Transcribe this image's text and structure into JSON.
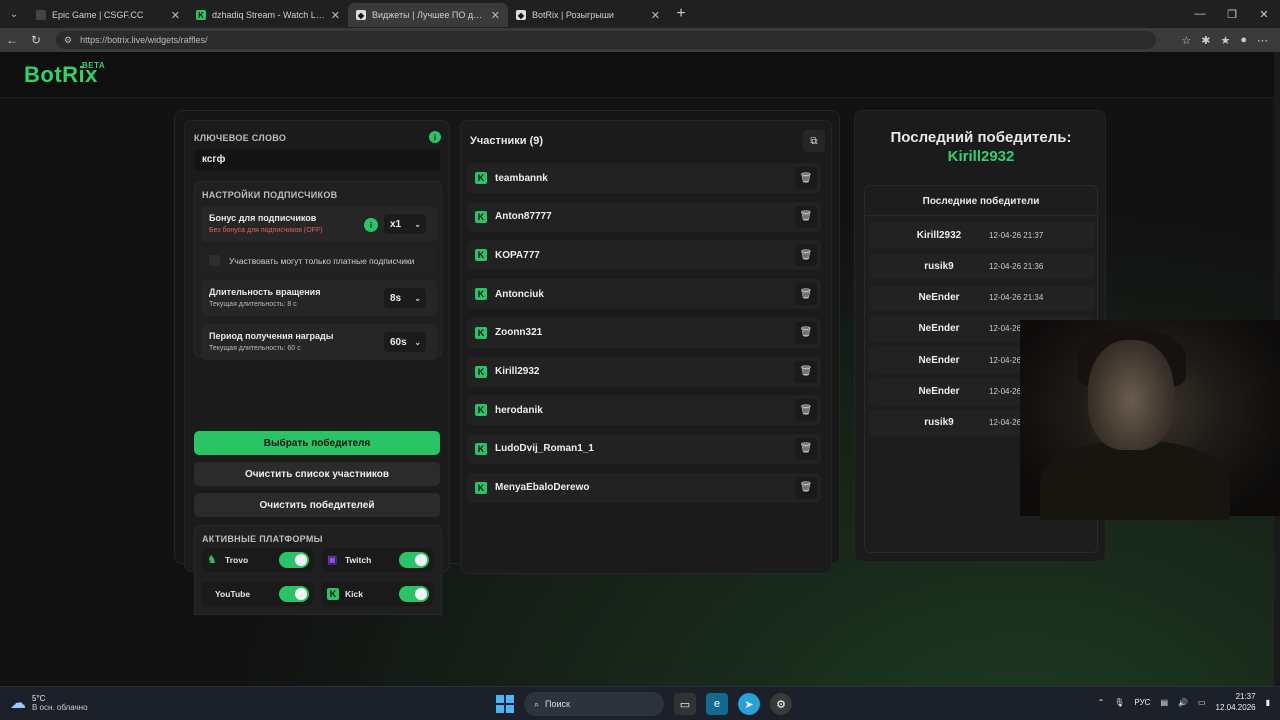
{
  "browser": {
    "tabs": [
      {
        "title": "Epic Game | CSGF.CC",
        "fav_color": "#444",
        "fav_glyph": ""
      },
      {
        "title": "dzhadiq Stream - Watch Live on K",
        "fav_color": "#28c466",
        "fav_glyph": "K"
      },
      {
        "title": "Виджеты | Лучшее ПО для улучш",
        "fav_color": "#ddd",
        "fav_glyph": "◆"
      },
      {
        "title": "BotRix | Розыгрыши",
        "fav_color": "#ddd",
        "fav_glyph": "◆"
      }
    ],
    "url": "https://botrix.live/widgets/raffles/"
  },
  "logo": {
    "name": "BotRix",
    "badge": "BETA"
  },
  "settings": {
    "keyword_label": "КЛЮЧЕВОЕ СЛОВО",
    "keyword_value": "ксгф",
    "subs_title": "НАСТРОЙКИ ПОДПИСЧИКОВ",
    "bonus_label": "Бонус для подписчиков",
    "bonus_sub": "Без бонуса для подписчиков (OFF)",
    "bonus_value": "x1",
    "paid_only_label": "Участвовать могут только платные подписчики",
    "spin_label": "Длительность вращения",
    "spin_sub": "Текущая длительность: 8 с",
    "spin_value": "8s",
    "claim_label": "Период получения награды",
    "claim_sub": "Текущая длительность: 60 с",
    "claim_value": "60s",
    "pick_winner": "Выбрать победителя",
    "clear_participants": "Очистить список участников",
    "clear_winners": "Очистить победителей",
    "platforms_title": "АКТИВНЫЕ ПЛАТФОРМЫ",
    "platforms": [
      {
        "name": "Trovo",
        "on": true
      },
      {
        "name": "Twitch",
        "on": true
      },
      {
        "name": "YouTube",
        "on": true
      },
      {
        "name": "Kick",
        "on": true
      }
    ]
  },
  "participants": {
    "title": "Участники (9)",
    "list": [
      "teambannk",
      "Anton87777",
      "KOPA777",
      "Antonciuk",
      "Zoonn321",
      "Kirill2932",
      "herodanik",
      "LudoDvij_Roman1_1",
      "MenyaEbaloDerewo"
    ]
  },
  "winners": {
    "title": "Последний победитель:",
    "last": "Kirill2932",
    "recent_title": "Последние победители",
    "list": [
      {
        "name": "Kirill2932",
        "date": "12-04-26 21:37"
      },
      {
        "name": "rusik9",
        "date": "12-04-26 21:36"
      },
      {
        "name": "NeEnder",
        "date": "12-04-26 21:34"
      },
      {
        "name": "NeEnder",
        "date": "12-04-26"
      },
      {
        "name": "NeEnder",
        "date": "12-04-26"
      },
      {
        "name": "NeEnder",
        "date": "12-04-26"
      },
      {
        "name": "rusik9",
        "date": "12-04-26 2"
      }
    ]
  },
  "taskbar": {
    "temp": "5°C",
    "weather": "В осн. облачно",
    "search": "Поиск",
    "lang": "РУС",
    "time": "21:37",
    "date": "12.04.2026"
  }
}
